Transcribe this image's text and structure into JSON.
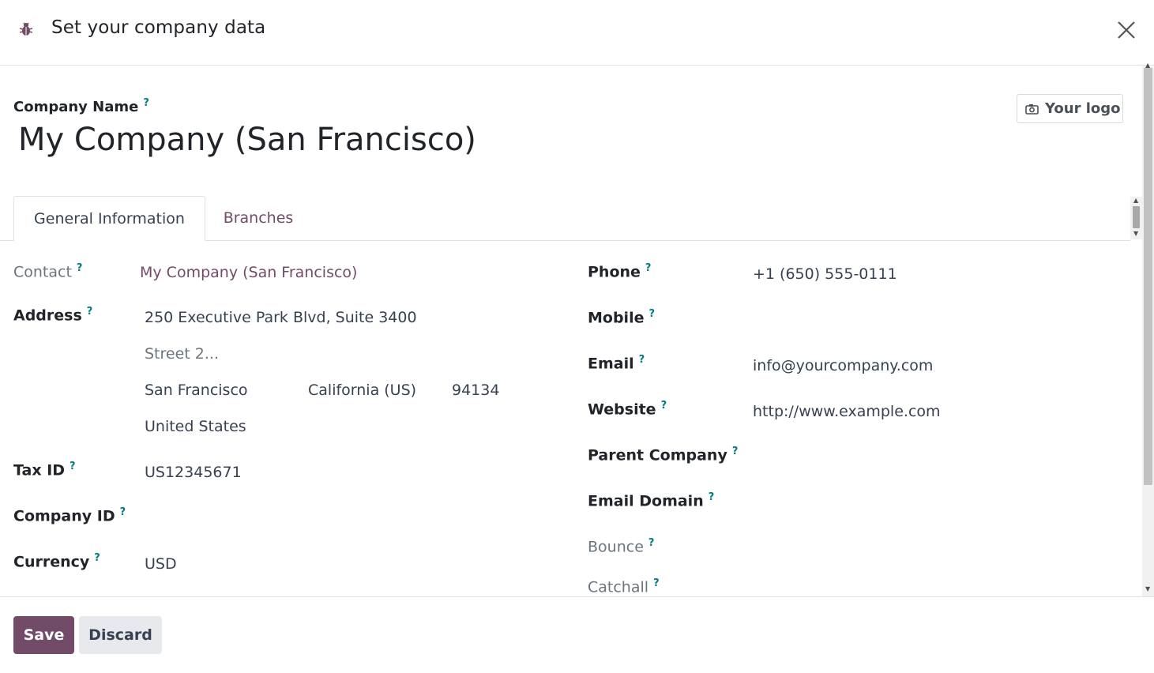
{
  "dialog": {
    "title": "Set your company data",
    "icon": "bug-icon",
    "close_icon": "close-icon"
  },
  "company": {
    "name_label": "Company Name",
    "help_mark": "?",
    "name": "My Company (San Francisco)",
    "logo_button": "Your logo",
    "logo_icon": "camera-icon"
  },
  "tabs": [
    {
      "label": "General Information",
      "active": true
    },
    {
      "label": "Branches",
      "active": false
    }
  ],
  "left_fields": {
    "contact": {
      "label": "Contact",
      "value": "My Company (San Francisco)"
    },
    "address": {
      "label": "Address",
      "street": "250 Executive Park Blvd, Suite 3400",
      "street2_placeholder": "Street 2...",
      "city": "San Francisco",
      "state": "California (US)",
      "zip": "94134",
      "country": "United States"
    },
    "tax_id": {
      "label": "Tax ID",
      "value": "US12345671"
    },
    "company_id": {
      "label": "Company ID",
      "value": ""
    },
    "currency": {
      "label": "Currency",
      "value": "USD"
    }
  },
  "right_fields": {
    "phone": {
      "label": "Phone",
      "value": "+1 (650) 555-0111"
    },
    "mobile": {
      "label": "Mobile",
      "value": ""
    },
    "email": {
      "label": "Email",
      "value": "info@yourcompany.com"
    },
    "website": {
      "label": "Website",
      "value": "http://www.example.com"
    },
    "parent_company": {
      "label": "Parent Company",
      "value": ""
    },
    "email_domain": {
      "label": "Email Domain",
      "value": ""
    },
    "bounce": {
      "label": "Bounce",
      "value": ""
    },
    "catchall": {
      "label": "Catchall",
      "value": ""
    }
  },
  "footer": {
    "save_label": "Save",
    "discard_label": "Discard"
  },
  "colors": {
    "brand": "#714b67",
    "help": "#017e84"
  }
}
